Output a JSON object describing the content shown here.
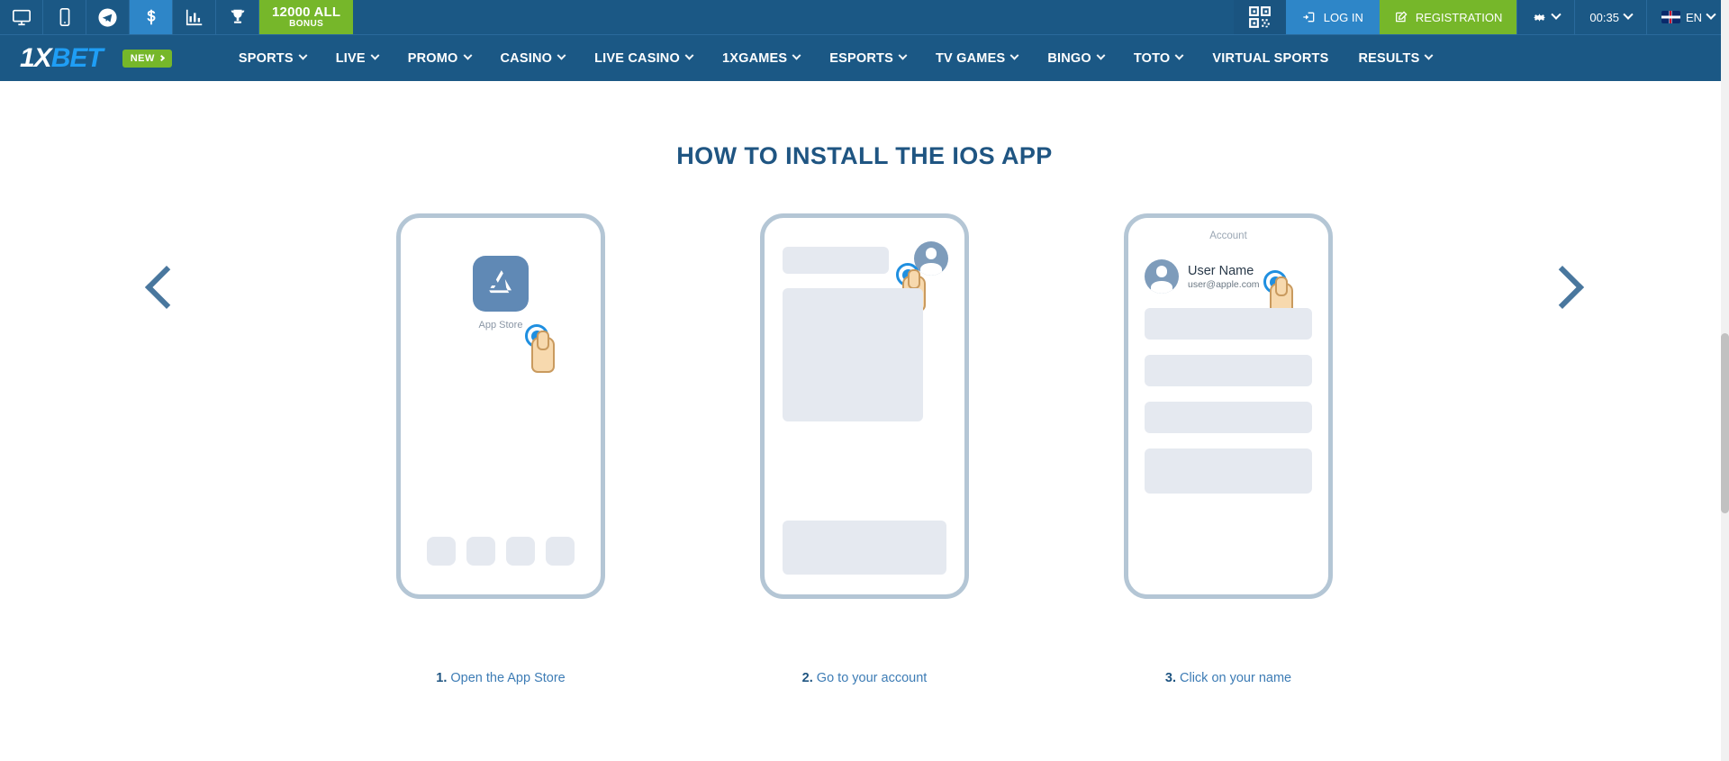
{
  "topbar": {
    "icons": [
      {
        "name": "desktop-icon",
        "label": "Desktop"
      },
      {
        "name": "mobile-icon",
        "label": "Mobile"
      },
      {
        "name": "telegram-icon",
        "label": "Telegram"
      },
      {
        "name": "dollar-icon",
        "label": "Payments"
      },
      {
        "name": "statistics-icon",
        "label": "Statistics"
      },
      {
        "name": "trophy-icon",
        "label": "Results"
      }
    ],
    "bonus": {
      "amount": "12000 ALL",
      "label": "BONUS"
    },
    "qr_label": "QR",
    "login_label": "LOG IN",
    "registration_label": "REGISTRATION",
    "time": "00:35",
    "language": "EN"
  },
  "nav": {
    "logo_first": "1X",
    "logo_second": "BET",
    "new_badge": "NEW",
    "items": [
      {
        "label": "SPORTS",
        "has_chevron": true
      },
      {
        "label": "LIVE",
        "has_chevron": true
      },
      {
        "label": "PROMO",
        "has_chevron": true
      },
      {
        "label": "CASINO",
        "has_chevron": true
      },
      {
        "label": "LIVE CASINO",
        "has_chevron": true
      },
      {
        "label": "1XGAMES",
        "has_chevron": true
      },
      {
        "label": "ESPORTS",
        "has_chevron": true
      },
      {
        "label": "TV GAMES",
        "has_chevron": true
      },
      {
        "label": "BINGO",
        "has_chevron": true
      },
      {
        "label": "TOTO",
        "has_chevron": true
      },
      {
        "label": "VIRTUAL SPORTS",
        "has_chevron": false
      },
      {
        "label": "RESULTS",
        "has_chevron": true
      }
    ]
  },
  "main": {
    "title": "HOW TO INSTALL THE IOS APP",
    "slides": [
      {
        "step_number": "1.",
        "caption": "Open the App Store",
        "app_label": "App Store"
      },
      {
        "step_number": "2.",
        "caption": "Go to your account"
      },
      {
        "step_number": "3.",
        "caption": "Click on your name",
        "account_title": "Account",
        "user_name": "User Name",
        "user_email": "user@apple.com"
      }
    ],
    "prev_label": "Previous",
    "next_label": "Next"
  },
  "colors": {
    "header_blue": "#1b5885",
    "accent_blue": "#2e86c8",
    "green": "#76b72a",
    "title_blue": "#1f5582",
    "caption_blue": "#3d7cb5"
  }
}
